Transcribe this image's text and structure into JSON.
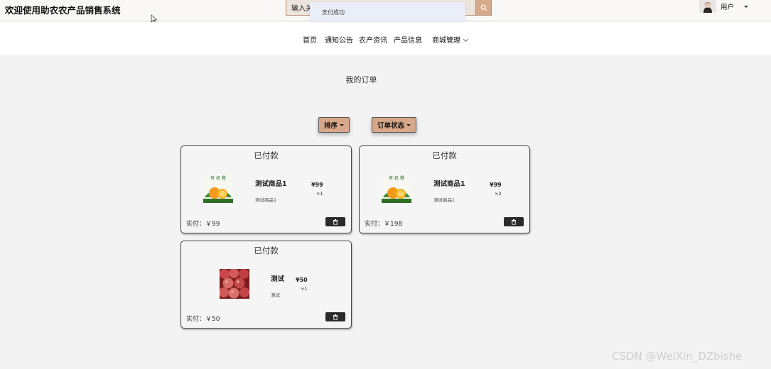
{
  "header": {
    "title": "欢迎使用助农农产品销售系统",
    "search": {
      "placeholder": "输入关",
      "value": "输入关"
    },
    "toast": "支付成功",
    "user": {
      "label": "用户"
    }
  },
  "nav": {
    "items": [
      {
        "label": "首页"
      },
      {
        "label": "通知公告"
      },
      {
        "label": "农产资讯"
      },
      {
        "label": "产品信息"
      },
      {
        "label": "商城管理"
      }
    ]
  },
  "main": {
    "title": "我的订单",
    "filters": {
      "sort_label": "排序",
      "status_label": "订单状态"
    },
    "orders": [
      {
        "status": "已付款",
        "image_icon": "orange-fruit-image",
        "name": "测试商品1",
        "desc": "测试商品1",
        "price": "¥99",
        "qty": "×1",
        "paid": "实付：￥99"
      },
      {
        "status": "已付款",
        "image_icon": "orange-fruit-image",
        "name": "测试商品1",
        "desc": "测试商品1",
        "price": "¥99",
        "qty": "×2",
        "paid": "实付：￥198"
      },
      {
        "status": "已付款",
        "image_icon": "apples-image",
        "name": "测试",
        "desc": "测试",
        "price": "¥50",
        "qty": "×1",
        "paid": "实付：￥50"
      }
    ]
  },
  "watermark": "CSDN @WeiXin_DZbishe",
  "colors": {
    "accent": "#d9a88a",
    "delete_button": "#2b2b2b",
    "toast_bg": "#e9eef8"
  }
}
